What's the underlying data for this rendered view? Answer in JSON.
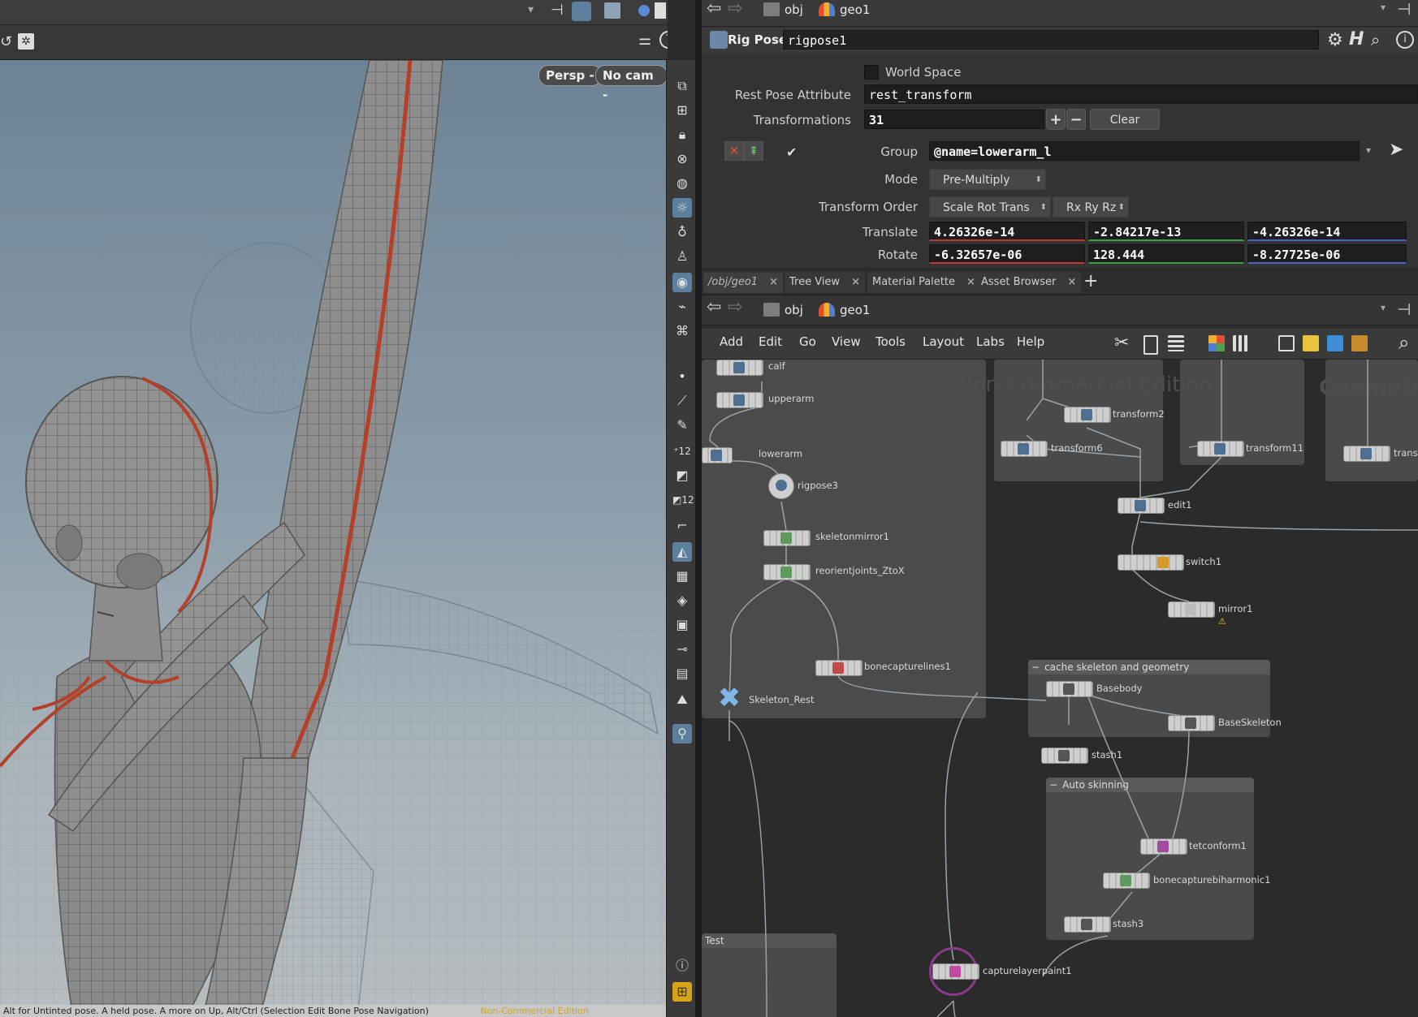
{
  "viewport": {
    "persp_label": "Persp -",
    "cam_label": "No cam -",
    "status_text": "Alt for Untinted pose. A held pose. A more on Up, Alt/Ctrl (Selection Edit Bone Pose Navigation)",
    "status_watermark": "Non-Commercial Edition"
  },
  "parameters": {
    "path": {
      "obj": "obj",
      "geo": "geo1"
    },
    "node_type": "Rig Pose",
    "node_name": "rigpose1",
    "world_space_label": "World Space",
    "rest_pose_label": "Rest Pose Attribute",
    "rest_pose_value": "rest_transform",
    "transformations_label": "Transformations",
    "transformations_value": "31",
    "plus_label": "+",
    "minus_label": "−",
    "clear_label": "Clear",
    "group_label": "Group",
    "group_value": "@name=lowerarm_l",
    "mode_label": "Mode",
    "mode_value": "Pre-Multiply",
    "transform_order_label": "Transform Order",
    "transform_order_value": "Scale Rot Trans",
    "rot_order_value": "Rx Ry Rz",
    "translate_label": "Translate",
    "translate_values": [
      "4.26326e-14",
      "-2.84217e-13",
      "-4.26326e-14"
    ],
    "rotate_label": "Rotate",
    "rotate_values": [
      "-6.32657e-06",
      "128.444",
      "-8.27725e-06"
    ]
  },
  "tabs": [
    {
      "label": "/obj/geo1"
    },
    {
      "label": "Tree View"
    },
    {
      "label": "Material Palette"
    },
    {
      "label": "Asset Browser"
    }
  ],
  "network": {
    "path": {
      "obj": "obj",
      "geo": "geo1"
    },
    "menu": [
      "Add",
      "Edit",
      "Go",
      "View",
      "Tools",
      "Layout",
      "Labs",
      "Help"
    ],
    "watermark_left": "Non-Commercial Edition",
    "watermark_right": "Geometr",
    "boxes": {
      "cache": "cache skeleton and geometry",
      "auto": "Auto skinning",
      "test": "Test"
    },
    "nodes": {
      "calf": "calf",
      "upperarm": "upperarm",
      "lowerarm": "lowerarm",
      "rigpose3": "rigpose3",
      "skeletonmirror1": "skeletonmirror1",
      "reorient": "reorientjoints_ZtoX",
      "bonecapturelines1": "bonecapturelines1",
      "skeleton_rest": "Skeleton_Rest",
      "transform2": "transform2",
      "transform6": "transform6",
      "transform11": "transform11",
      "transf": "transf",
      "edit1": "edit1",
      "switch1": "switch1",
      "mirror1": "mirror1",
      "basebody": "Basebody",
      "baseskeleton": "BaseSkeleton",
      "stash1": "stash1",
      "tetconform1": "tetconform1",
      "bonecapturebiharmonic1": "bonecapturebiharmonic1",
      "stash3": "stash3",
      "capturelayerpaint1": "capturelayerpaint1"
    }
  },
  "colors": {
    "accent_blue": "#5b7f9c",
    "translate_x_underline": "#c0392b",
    "translate_y_underline": "#3aa04a",
    "translate_z_underline": "#4a62c8",
    "muscle_red": "#b5402a"
  }
}
